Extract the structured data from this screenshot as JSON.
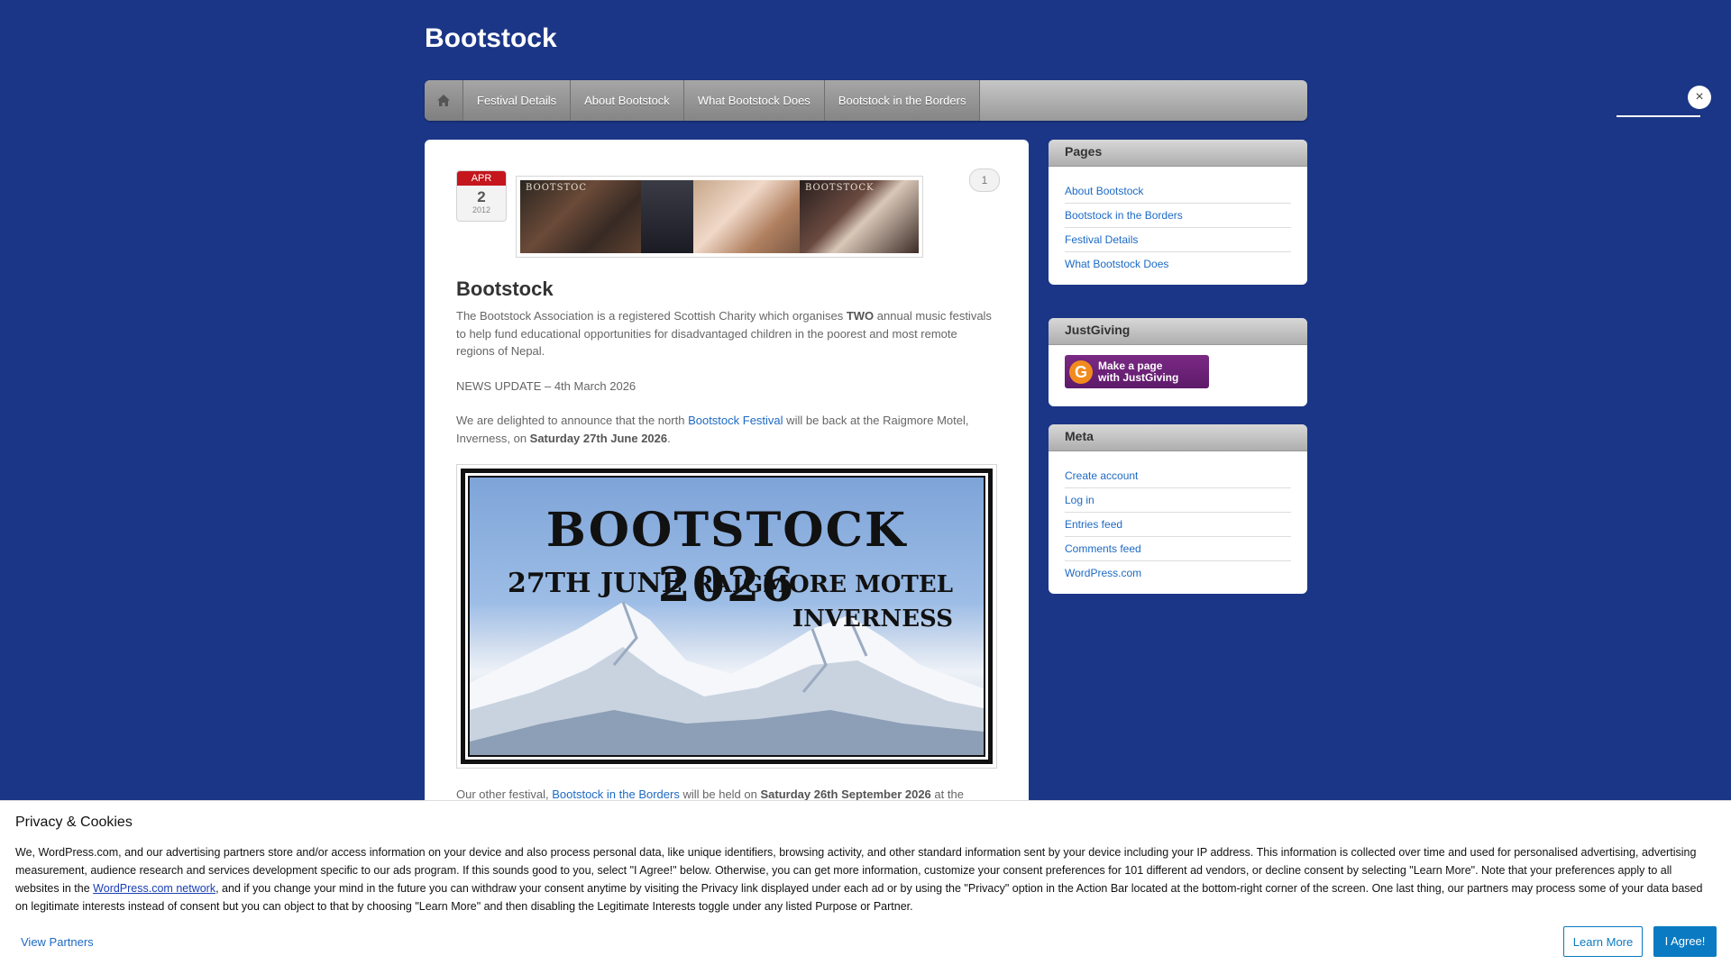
{
  "site": {
    "title": "Bootstock"
  },
  "nav": {
    "home_icon": "home-icon",
    "items": [
      {
        "label": "Festival Details"
      },
      {
        "label": "About Bootstock"
      },
      {
        "label": "What Bootstock Does"
      },
      {
        "label": "Bootstock in the Borders"
      }
    ]
  },
  "close": {
    "icon": "close-icon",
    "glyph": "×"
  },
  "post": {
    "date": {
      "month": "APR",
      "day": "2",
      "year": "2012"
    },
    "comment_count": "1",
    "banner_text_1": "BOOTSTOC",
    "banner_text_2": "BOOTSTOCK",
    "title": "Bootstock",
    "p1_pre": "The Bootstock Association is a registered Scottish Charity which organises ",
    "p1_bold": "TWO",
    "p1_post": " annual music festivals to help fund educational opportunities for disadvantaged children in the poorest and most remote regions of Nepal.",
    "news": "NEWS UPDATE – 4th March 2026",
    "p3_pre": "We are delighted to announce that the north ",
    "p3_link": "Bootstock Festival",
    "p3_mid": " will be back at the Raigmore Motel, Inverness, on ",
    "p3_bold": "Saturday 27th June 2026",
    "p3_end": ".",
    "poster": {
      "title": "BOOTSTOCK  2026",
      "date": "27TH JUNE",
      "venue_1": "RAIGMORE MOTEL",
      "venue_2": "INVERNESS"
    },
    "p4_pre": "Our other festival, ",
    "p4_link": "Bootstock in the Borders",
    "p4_mid": " will be held on ",
    "p4_bold": "Saturday 26th September 2026",
    "p4_end": " at the"
  },
  "sidebar": {
    "pages": {
      "title": "Pages",
      "items": [
        "About Bootstock",
        "Bootstock in the Borders",
        "Festival Details",
        "What Bootstock Does"
      ]
    },
    "justgiving": {
      "title": "JustGiving",
      "logo_letter": "G",
      "button_line1": "Make a page",
      "button_line2": "with JustGiving"
    },
    "meta": {
      "title": "Meta",
      "items": [
        "Create account",
        "Log in",
        "Entries feed",
        "Comments feed",
        "WordPress.com"
      ]
    }
  },
  "cookie": {
    "title": "Privacy & Cookies",
    "text_pre": "We, WordPress.com, and our advertising partners store and/or access information on your device and also process personal data, like unique identifiers, browsing activity, and other standard information sent by your device including your IP address. This information is collected over time and used for personalised advertising, advertising measurement, audience research and services development specific to our ads program. If this sounds good to you, select \"I Agree!\" below. Otherwise, you can get more information, customize your consent preferences for 101 different ad vendors, or decline consent by selecting \"Learn More\". Note that your preferences apply to all websites in the ",
    "text_link": "WordPress.com network",
    "text_post": ", and if you change your mind in the future you can withdraw your consent anytime by visiting the Privacy link displayed under each ad or by using the \"Privacy\" option in the Action Bar located at the bottom-right corner of the screen. One last thing, our partners may process some of your data based on legitimate interests instead of consent but you can object to that by choosing \"Learn More\" and then disabling the Legitimate Interests toggle under any listed Purpose or Partner.",
    "view_partners": "View Partners",
    "learn_more": "Learn More",
    "agree": "I Agree!"
  },
  "colors": {
    "background": "#1b3686",
    "link": "#1d6ac4",
    "date_red": "#c4161c",
    "button_blue": "#0a7ac2",
    "justgiving_purple": "#6b2277"
  }
}
